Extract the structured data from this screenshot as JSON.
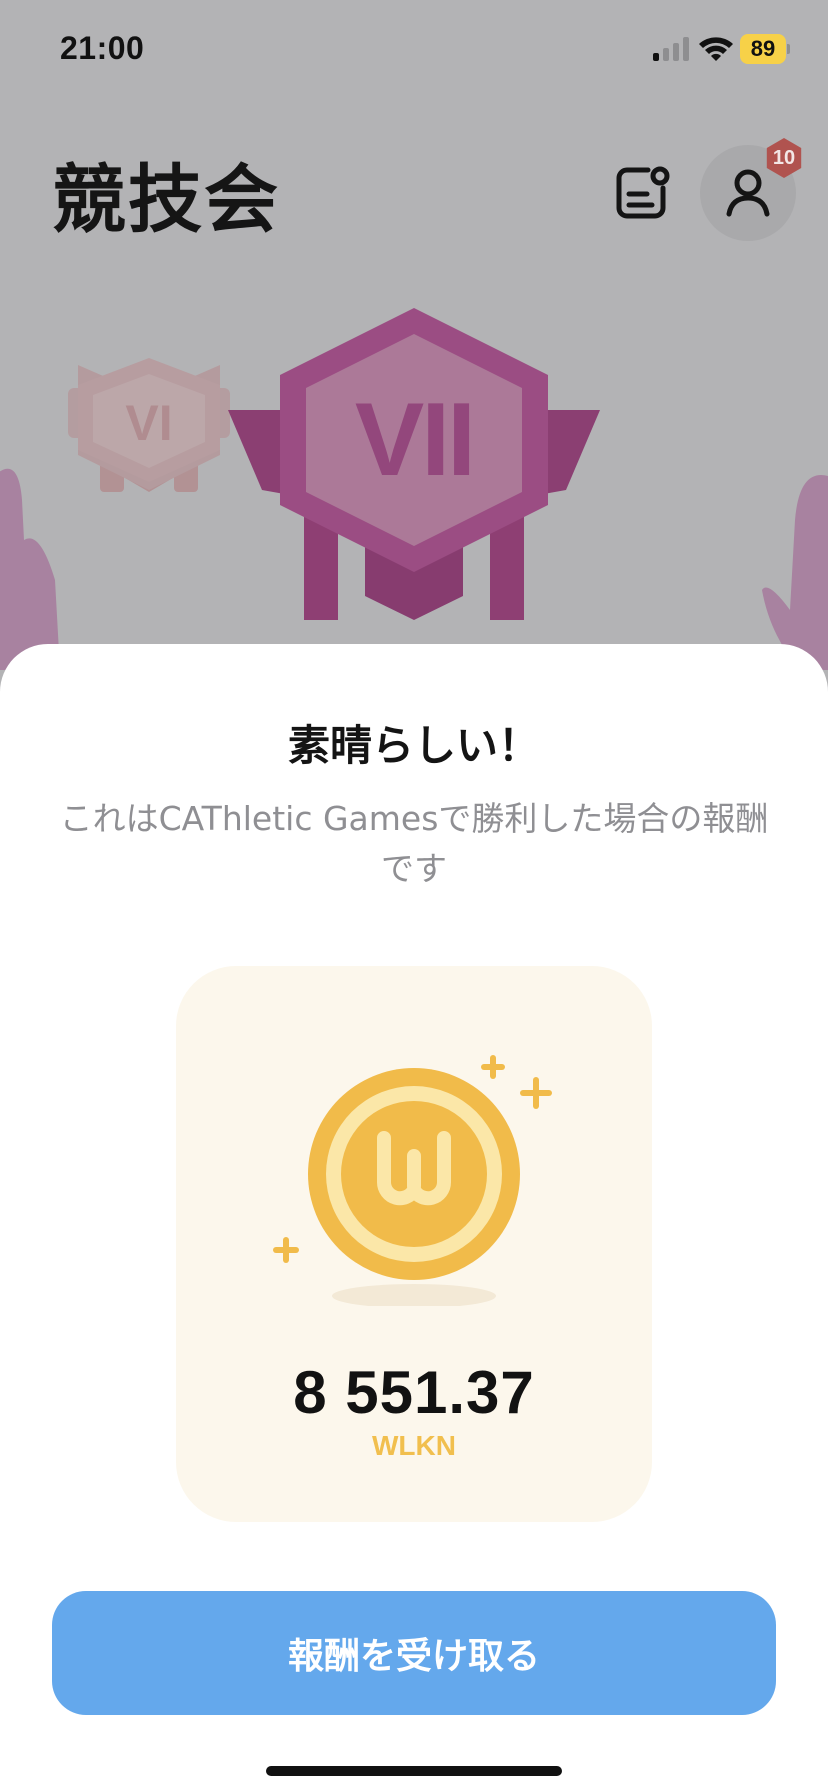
{
  "status_bar": {
    "time": "21:00",
    "battery": "89"
  },
  "header": {
    "title": "競技会",
    "notification_count": "10"
  },
  "league": {
    "current": "VII",
    "previous": "VI"
  },
  "sheet": {
    "title": "素晴らしい！",
    "description": "これはCAThletic Gamesで勝利した場合の報酬です",
    "reward_amount": "8 551.37",
    "reward_unit": "WLKN",
    "claim_label": "報酬を受け取る"
  },
  "colors": {
    "accent_button": "#64a8ec",
    "coin": "#f1bb4a",
    "league_badge": "#9b4d83",
    "badge": "#b0534f"
  },
  "icons": [
    "signal-icon",
    "wifi-icon",
    "news-icon",
    "profile-icon",
    "coin-icon",
    "sparkle-icon"
  ]
}
